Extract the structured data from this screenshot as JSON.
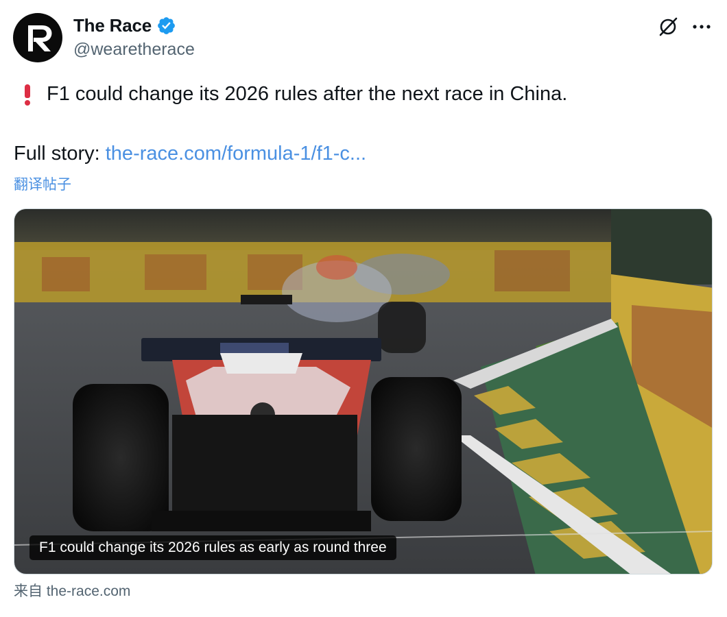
{
  "author": {
    "display_name": "The Race",
    "handle": "@wearetherace",
    "avatar_letter": "R",
    "verified": true
  },
  "icons": {
    "verified": "verified-badge-icon",
    "grok": "grok-icon",
    "more": "more-horizontal-icon",
    "exclamation": "red-exclamation-icon"
  },
  "tweet": {
    "text_line1": "F1 could change its 2026 rules after the next race in China.",
    "full_story_label": "Full story: ",
    "link_text": "the-race.com/formula-1/f1-c...",
    "translate_label": "翻译帖子"
  },
  "card": {
    "caption": "F1 could change its 2026 rules as early as round three",
    "source": "来自 the-race.com"
  },
  "colors": {
    "accent": "#1d9bf0",
    "link": "#4a90e2",
    "text": "#0f1419",
    "secondary": "#536471",
    "exclamation": "#dd2e44"
  }
}
